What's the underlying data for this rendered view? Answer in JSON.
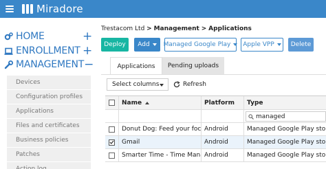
{
  "app": {
    "title": "Miradore"
  },
  "sidebar": {
    "main": [
      {
        "label": "HOME",
        "toggle": "+"
      },
      {
        "label": "ENROLLMENT",
        "toggle": "+"
      },
      {
        "label": "MANAGEMENT",
        "toggle": "−"
      }
    ],
    "sub": [
      "Devices",
      "Configuration profiles",
      "Applications",
      "Files and certificates",
      "Business policies",
      "Patches",
      "Action log"
    ]
  },
  "breadcrumb": {
    "org": "Trestacom Ltd",
    "sep": ">",
    "section": "Management",
    "page": "Applications"
  },
  "toolbar": {
    "deploy": "Deploy",
    "add": "Add",
    "gplay": "Managed Google Play",
    "vpp": "Apple VPP",
    "delete": "Delete"
  },
  "tabs": {
    "applications": "Applications",
    "pending": "Pending uploads"
  },
  "controls": {
    "select_columns": "Select columns",
    "refresh": "Refresh"
  },
  "table": {
    "headers": {
      "name": "Name",
      "platform": "Platform",
      "type": "Type"
    },
    "filter": {
      "type_value": "managed"
    },
    "rows": [
      {
        "name": "Donut Dog: Feed your focu…",
        "platform": "Android",
        "type": "Managed Google Play store",
        "checked": false
      },
      {
        "name": "Gmail",
        "platform": "Android",
        "type": "Managed Google Play store",
        "checked": true
      },
      {
        "name": "Smarter Time - Time Mana…",
        "platform": "Android",
        "type": "Managed Google Play store",
        "checked": false
      }
    ]
  },
  "colors": {
    "accent": "#3a87c9",
    "deploy": "#18b6a3",
    "nav": "#2f78c1"
  }
}
